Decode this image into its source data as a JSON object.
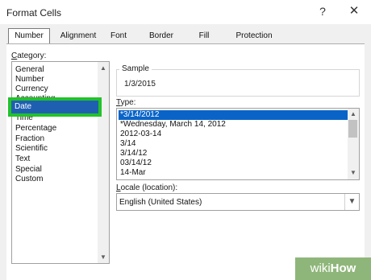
{
  "window": {
    "title": "Format Cells",
    "help": "?",
    "close": "✕"
  },
  "tabs": [
    {
      "label": "Number",
      "active": true
    },
    {
      "label": "Alignment"
    },
    {
      "label": "Font"
    },
    {
      "label": "Border"
    },
    {
      "label": "Fill"
    },
    {
      "label": "Protection"
    }
  ],
  "category": {
    "label_prefix": "C",
    "label_rest": "ategory:",
    "items": [
      "General",
      "Number",
      "Currency",
      "Accounting",
      "Date",
      "Time",
      "Percentage",
      "Fraction",
      "Scientific",
      "Text",
      "Special",
      "Custom"
    ],
    "selected": "Date"
  },
  "sample": {
    "label": "Sample",
    "value": "1/3/2015"
  },
  "type": {
    "label_prefix": "T",
    "label_rest": "ype:",
    "items": [
      "*3/14/2012",
      "*Wednesday, March 14, 2012",
      "2012-03-14",
      "3/14",
      "3/14/12",
      "03/14/12",
      "14-Mar"
    ],
    "selected_index": 0
  },
  "locale": {
    "label_prefix": "L",
    "label_rest": "ocale (location):",
    "value": "English (United States)"
  },
  "watermark": {
    "wiki": "wiki",
    "how": "How"
  },
  "colors": {
    "selection_blue": "#0a64c8",
    "highlight_green": "#22c22a",
    "watermark_green": "#8fb67a"
  }
}
